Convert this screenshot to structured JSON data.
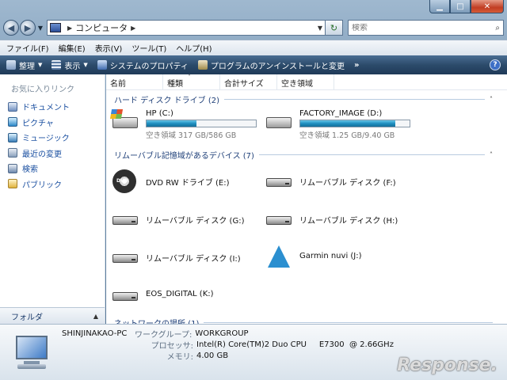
{
  "address": {
    "crumb": "コンピュータ"
  },
  "search": {
    "placeholder": "検索"
  },
  "menu": [
    "ファイル(F)",
    "編集(E)",
    "表示(V)",
    "ツール(T)",
    "ヘルプ(H)"
  ],
  "commands": {
    "organize": "整理",
    "views": "表示",
    "system_properties": "システムのプロパティ",
    "uninstall": "プログラムのアンインストールと変更",
    "more": "»",
    "help": "?"
  },
  "sidebar": {
    "favorites_header": "お気に入りリンク",
    "items": [
      {
        "label": "ドキュメント",
        "icon": "documents-icon"
      },
      {
        "label": "ピクチャ",
        "icon": "pictures-icon"
      },
      {
        "label": "ミュージック",
        "icon": "music-icon"
      },
      {
        "label": "最近の変更",
        "icon": "recent-icon"
      },
      {
        "label": "検索",
        "icon": "search-folder-icon"
      },
      {
        "label": "パブリック",
        "icon": "public-folder-icon"
      }
    ],
    "folders_label": "フォルダ"
  },
  "columns": [
    "名前",
    "種類",
    "合計サイズ",
    "空き領域"
  ],
  "groups": {
    "hard_disks": "ハード ディスク ドライブ (2)",
    "removable": "リムーバブル記憶域があるデバイス (7)",
    "network": "ネットワークの場所 (1)"
  },
  "hard_drives": [
    {
      "name": "HP (C:)",
      "space": "空き領域 317 GB/586 GB",
      "used_fraction": 0.46
    },
    {
      "name": "FACTORY_IMAGE (D:)",
      "space": "空き領域 1.25 GB/9.40 GB",
      "used_fraction": 0.87
    }
  ],
  "removable_drives": [
    {
      "name": "DVD RW ドライブ (E:)",
      "icon": "dvd-drive-icon"
    },
    {
      "name": "リムーバブル ディスク (F:)",
      "icon": "removable-disk-icon"
    },
    {
      "name": "リムーバブル ディスク (G:)",
      "icon": "removable-disk-icon"
    },
    {
      "name": "リムーバブル ディスク (H:)",
      "icon": "removable-disk-icon"
    },
    {
      "name": "リムーバブル ディスク (I:)",
      "icon": "removable-disk-icon"
    },
    {
      "name": "Garmin nuvi (J:)",
      "icon": "garmin-icon"
    },
    {
      "name": "EOS_DIGITAL (K:)",
      "icon": "removable-disk-icon"
    }
  ],
  "details": {
    "pc_name": "SHINJINAKAO-PC",
    "workgroup_label": "ワークグループ:",
    "workgroup": "WORKGROUP",
    "processor_label": "プロセッサ:",
    "processor": "Intel(R) Core(TM)2 Duo CPU     E7300  @ 2.66GHz",
    "memory_label": "メモリ:",
    "memory": "4.00 GB"
  },
  "watermark": "Response."
}
